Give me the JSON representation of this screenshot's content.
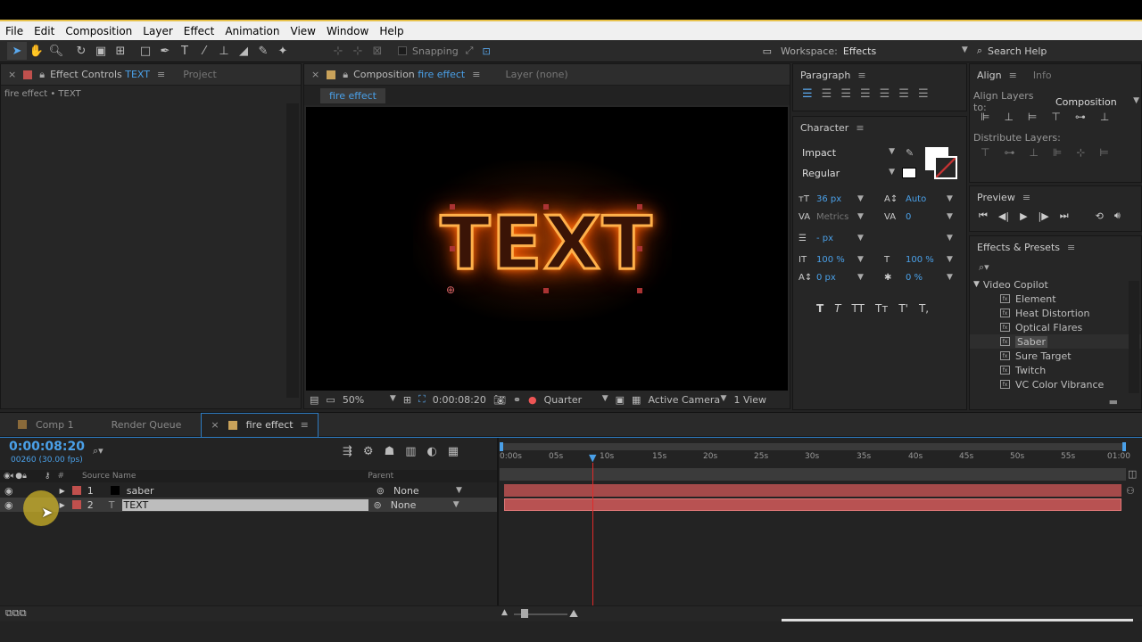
{
  "menu": [
    "File",
    "Edit",
    "Composition",
    "Layer",
    "Effect",
    "Animation",
    "View",
    "Window",
    "Help"
  ],
  "toolbar": {
    "snapping": "Snapping",
    "workspace_label": "Workspace:",
    "workspace_value": "Effects",
    "search_help": "Search Help"
  },
  "left_panel": {
    "tab_active": "Effect Controls",
    "tab_active_target": "TEXT",
    "tab_inactive": "Project",
    "breadcrumb": "fire effect • TEXT"
  },
  "comp_panel": {
    "tab_prefix": "Composition",
    "tab_name": "fire effect",
    "layer_tab": "Layer (none)",
    "sub_tab": "fire effect",
    "canvas_text": "TEXT",
    "zoom": "50%",
    "timecode": "0:00:08:20",
    "resolution": "Quarter",
    "camera": "Active Camera",
    "views": "1 View"
  },
  "paragraph": {
    "title": "Paragraph"
  },
  "character": {
    "title": "Character",
    "font": "Impact",
    "style": "Regular",
    "size": "36 px",
    "leading": "Auto",
    "kerning": "Metrics",
    "tracking": "0",
    "stroke": "- px",
    "vscale": "100 %",
    "hscale": "100 %",
    "baseline": "0 px",
    "tsume": "0 %",
    "text_styles": [
      "T",
      "T",
      "TT",
      "Tт",
      "T'",
      "T,"
    ]
  },
  "align": {
    "title": "Align",
    "info_tab": "Info",
    "align_to_label": "Align Layers to:",
    "align_to_value": "Composition",
    "distribute_label": "Distribute Layers:"
  },
  "preview": {
    "title": "Preview"
  },
  "effects_presets": {
    "title": "Effects & Presets",
    "category": "Video Copilot",
    "items": [
      "Element",
      "Heat Distortion",
      "Optical Flares",
      "Saber",
      "Sure Target",
      "Twitch",
      "VC Color Vibrance"
    ],
    "highlighted": "Saber"
  },
  "timeline": {
    "tabs": [
      "Comp 1",
      "Render Queue",
      "fire effect"
    ],
    "timecode": "0:00:08:20",
    "frames": "00260 (30.00 fps)",
    "col_num": "#",
    "col_source": "Source Name",
    "col_parent": "Parent",
    "ruler": [
      "0:00s",
      "05s",
      "10s",
      "15s",
      "20s",
      "25s",
      "30s",
      "35s",
      "40s",
      "45s",
      "50s",
      "55s",
      "01:00"
    ],
    "layers": [
      {
        "num": "1",
        "name": "saber",
        "parent": "None"
      },
      {
        "num": "2",
        "name": "TEXT",
        "parent": "None"
      }
    ]
  },
  "colors": {
    "accent": "#4aa0e8",
    "label_red": "#c0504d",
    "bar_red": "#a54a4a",
    "playhead": "#e02a2a",
    "fire": "#ff8a1e"
  }
}
